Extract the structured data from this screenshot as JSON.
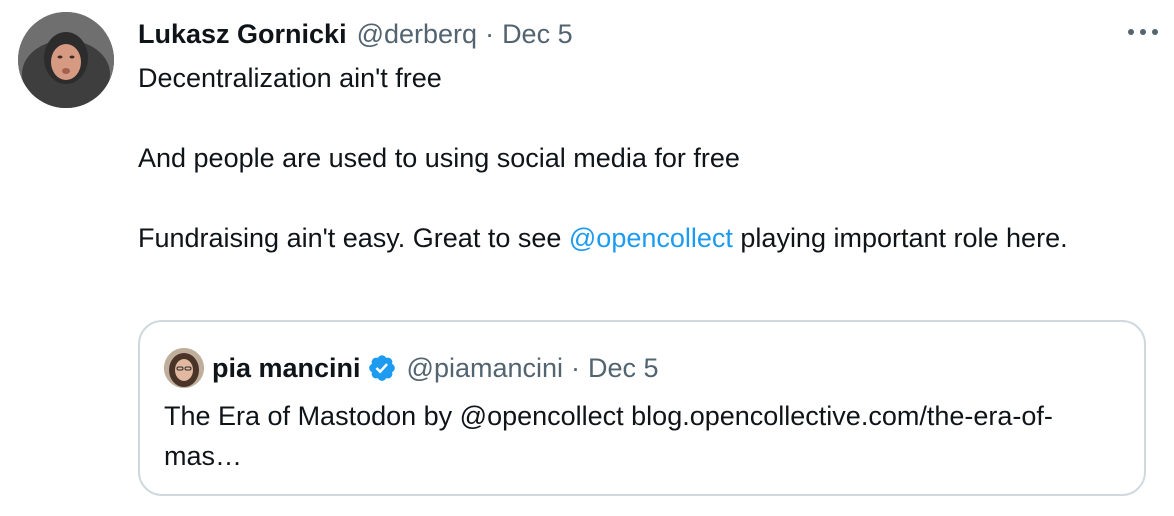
{
  "tweet": {
    "author_name": "Lukasz Gornicki",
    "author_handle": "@derberq",
    "separator": "·",
    "date": "Dec 5",
    "line1": "Decentralization ain't free",
    "line2": "And people are used to using social media for free",
    "line3_before": "Fundraising ain't easy. Great to see ",
    "line3_mention": "@opencollect",
    "line3_after": " playing important role here."
  },
  "quote": {
    "author_name": "pia mancini",
    "author_handle": "@piamancini",
    "separator": "·",
    "date": "Dec 5",
    "text": "The Era of Mastodon by @opencollect  blog.opencollective.com/the-era-of-mas…"
  },
  "icons": {
    "more": "more-horizontal-icon",
    "verified": "verified-badge-icon"
  },
  "colors": {
    "link": "#1d9bf0",
    "secondary_text": "#536471",
    "border": "#cfd9de",
    "verified": "#1d9bf0"
  }
}
